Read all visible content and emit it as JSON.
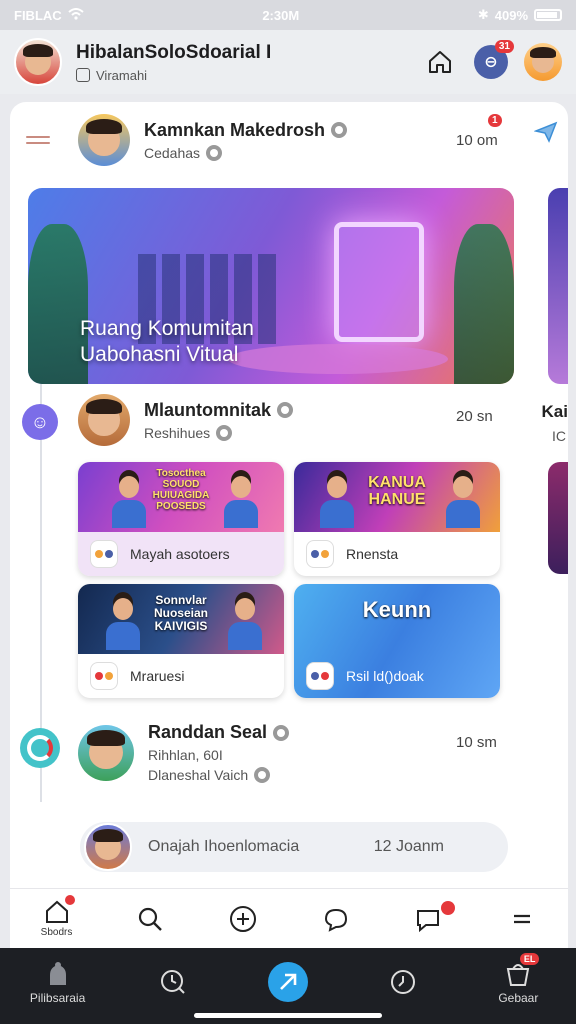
{
  "status": {
    "left": "FIBLAC",
    "time": "2:30M",
    "battery": "409%"
  },
  "header": {
    "title": "HibalanSoloSdoarial I",
    "subtitle": "Viramahi",
    "message_badge": "31",
    "message_glyph": "⊖"
  },
  "posts": [
    {
      "name": "Kamnkan Makedrosh",
      "sub": "Cedahas",
      "time": "10 om",
      "badge": "1",
      "banner_title_line1": "Ruang Komumitan",
      "banner_title_line2": "Uabohasni Vitual"
    },
    {
      "name": "Mlauntomnitak",
      "sub": "Reshihues",
      "time": "20 sn",
      "peek_name": "Kai",
      "peek_sub": "IC",
      "cards": [
        {
          "art_text": "Tosocthea\nSOUOD\nHUIUAGIDA\nPOOSEDS",
          "caption": "Mayah asotoers"
        },
        {
          "art_text": "KANUA\nHANUE",
          "caption": "Rnensta"
        },
        {
          "art_text": "Sonnvlar\nNuoseian\nKAIVIGIS",
          "caption": "Mraruesi"
        },
        {
          "art_text": "Keunn",
          "caption": "Rsil ld()doak"
        }
      ]
    },
    {
      "name": "Randdan Seal",
      "sub1": "Rihhlan, 60I",
      "sub2": "Dlaneshal Vaich",
      "time": "10 sm"
    }
  ],
  "comment": {
    "text": "Onajah Ihoenlomacia",
    "count": "12 Joanm"
  },
  "inner_nav": {
    "home_label": "Sbodrs"
  },
  "bottom_bar": {
    "left_label": "Pilibsaraia",
    "right_label": "Gebaar",
    "right_badge": "EL"
  },
  "colors": {
    "accent": "#2aa2e8",
    "badge": "#e5383b",
    "rail": "#7b6de8"
  }
}
